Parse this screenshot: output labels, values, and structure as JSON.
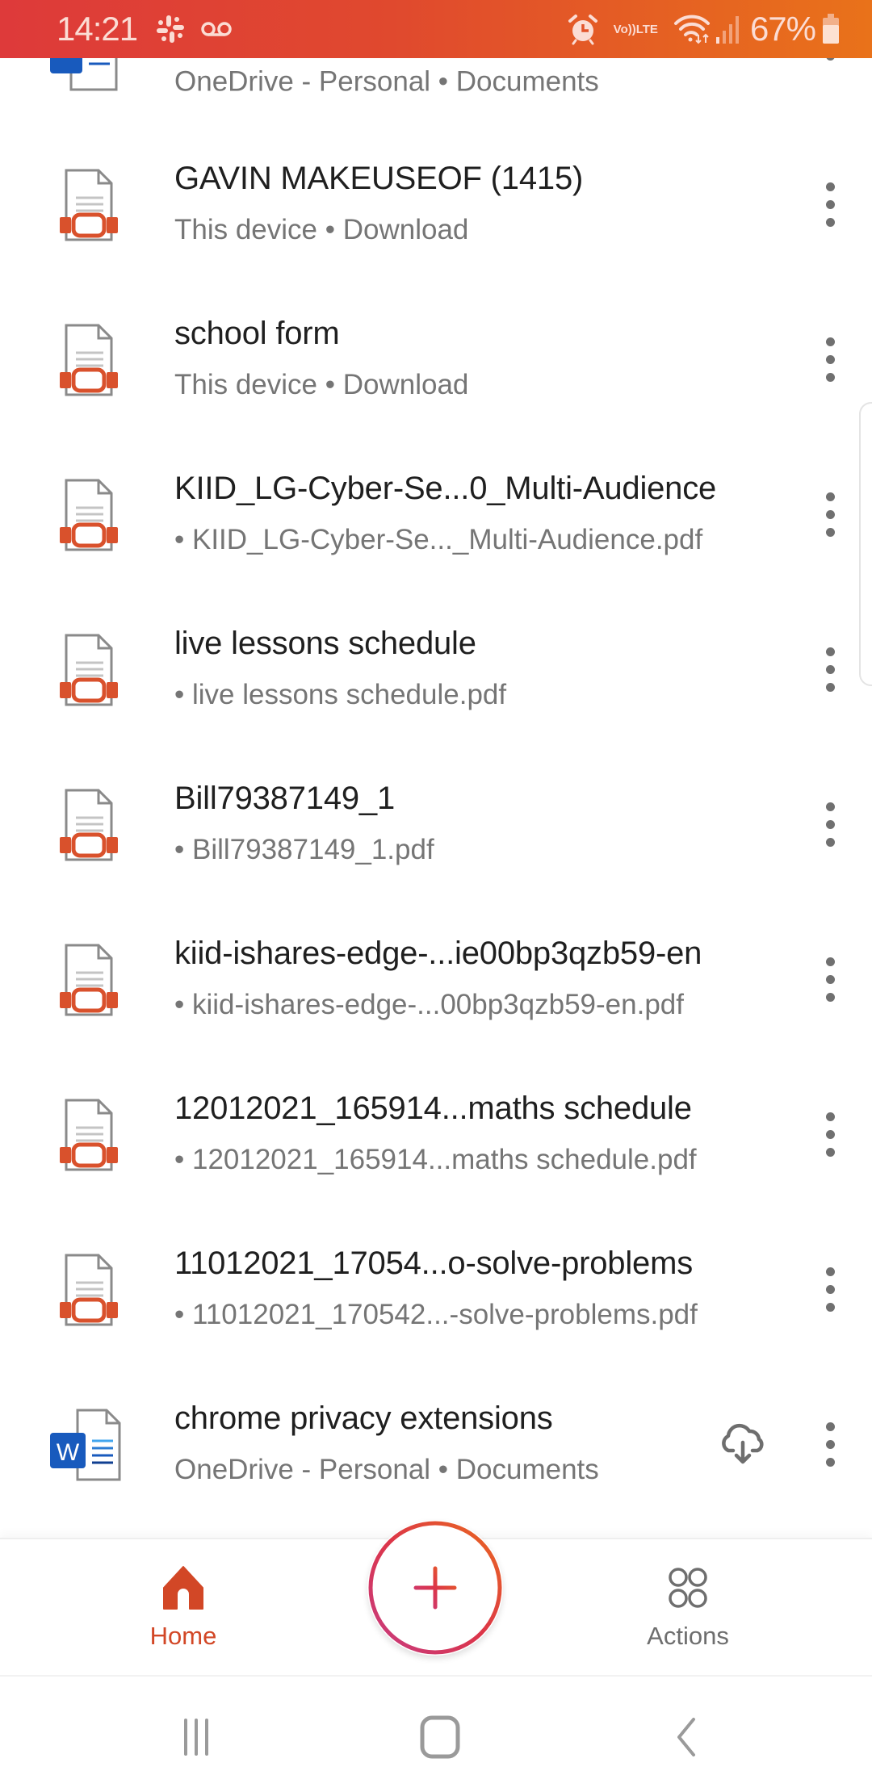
{
  "status_bar": {
    "time": "14:21",
    "notification_icons": [
      "slack-icon",
      "voicemail-icon"
    ],
    "system_icons": [
      "alarm-icon",
      "volte-icon",
      "wifi-icon",
      "signal-icon",
      "battery-icon"
    ],
    "volte_label_top": "Vo))",
    "volte_label_bottom": "LTE",
    "battery_percent": "67%"
  },
  "files": [
    {
      "name": "",
      "location": "OneDrive - Personal • Documents",
      "type": "word",
      "action_icon": "download-arrow-icon"
    },
    {
      "name": "GAVIN MAKEUSEOF (1415)",
      "location": "This device • Download",
      "type": "pdf"
    },
    {
      "name": "school form",
      "location": "This device • Download",
      "type": "pdf"
    },
    {
      "name": "KIID_LG-Cyber-Se...0_Multi-Audience",
      "location": "• KIID_LG-Cyber-Se..._Multi-Audience.pdf",
      "type": "pdf"
    },
    {
      "name": "live lessons schedule",
      "location": "• live lessons schedule.pdf",
      "type": "pdf"
    },
    {
      "name": "Bill79387149_1",
      "location": "• Bill79387149_1.pdf",
      "type": "pdf"
    },
    {
      "name": "kiid-ishares-edge-...ie00bp3qzb59-en",
      "location": "• kiid-ishares-edge-...00bp3qzb59-en.pdf",
      "type": "pdf"
    },
    {
      "name": "12012021_165914...maths schedule",
      "location": "• 12012021_165914...maths schedule.pdf",
      "type": "pdf"
    },
    {
      "name": "11012021_17054...o-solve-problems",
      "location": "• 11012021_170542...-solve-problems.pdf",
      "type": "pdf"
    },
    {
      "name": "chrome privacy extensions",
      "location": "OneDrive - Personal • Documents",
      "type": "word",
      "action_icon": "cloud-download-icon"
    }
  ],
  "bottom_nav": {
    "home_label": "Home",
    "actions_label": "Actions",
    "create_icon": "plus-icon"
  },
  "colors": {
    "accent": "#d24726",
    "pdf_red": "#d9512c",
    "word_blue": "#185abd",
    "status_gradient_start": "#de3a3a",
    "status_gradient_end": "#e9721a"
  }
}
